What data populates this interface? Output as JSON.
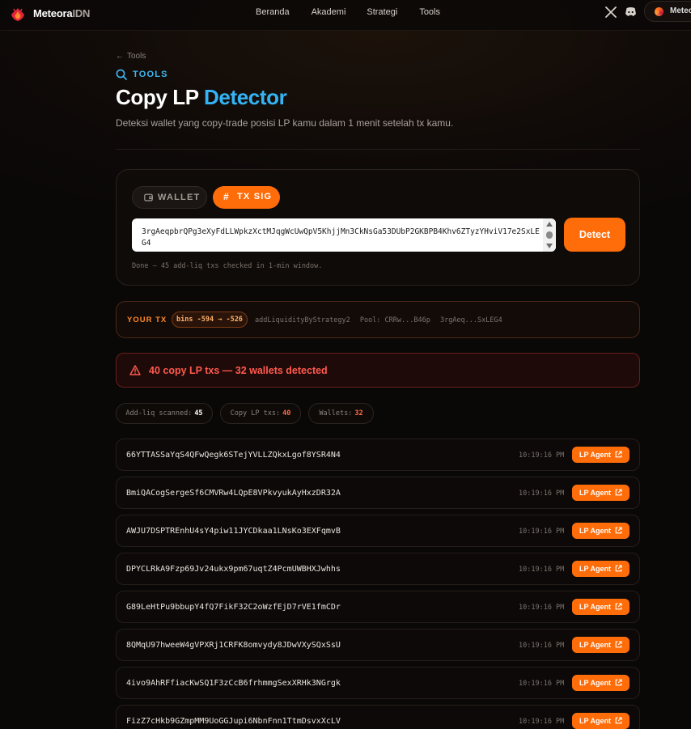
{
  "nav": {
    "brand_main": "Meteora",
    "brand_suffix": "IDN",
    "links": [
      "Beranda",
      "Akademi",
      "Strategi",
      "Tools"
    ],
    "app_label": "Meteo"
  },
  "header": {
    "back_label": "Tools",
    "section_label": "TOOLS",
    "title_white": "Copy LP",
    "title_accent": "Detector",
    "subtitle": "Deteksi wallet yang copy-trade posisi LP kamu dalam 1 menit setelah tx kamu."
  },
  "input_card": {
    "tabs": [
      {
        "label": "WALLET",
        "active": false
      },
      {
        "label": "TX SIG",
        "active": true
      }
    ],
    "signature_value": "3rgAeqpbrQPg3eXyFdLLWpkzXctMJqgWcUwQpV5KhjjMn3CkNsGa53DUbP2GKBPB4Khv6ZTyzYHviV17e2SxLEG4",
    "detect_label": "Detect",
    "status": "Done — 45 add-liq txs checked in 1-min window."
  },
  "your_tx": {
    "label": "YOUR TX",
    "bins": "bins -594 → -526",
    "method": "addLiquidityByStrategy2",
    "pool": "Pool: CRRw...B46p",
    "sig": "3rgAeq...SxLEG4"
  },
  "alert": {
    "text": "40 copy LP txs — 32 wallets detected"
  },
  "stats": {
    "scanned_label": "Add-liq scanned:",
    "scanned_value": "45",
    "copy_label": "Copy LP txs:",
    "copy_value": "40",
    "wallets_label": "Wallets:",
    "wallets_value": "32"
  },
  "results": [
    {
      "address": "66YTTASSaYqS4QFwQegk6STejYVLLZQkxLgof8YSR4N4",
      "time": "10:19:16 PM",
      "action": "LP Agent"
    },
    {
      "address": "BmiQACogSergeSf6CMVRw4LQpE8VPkvyukAyHxzDR32A",
      "time": "10:19:16 PM",
      "action": "LP Agent"
    },
    {
      "address": "AWJU7DSPTREnhU4sY4piw11JYCDkaa1LNsKo3EXFqmvB",
      "time": "10:19:16 PM",
      "action": "LP Agent"
    },
    {
      "address": "DPYCLRkA9Fzp69Jv24ukx9pm67uqtZ4PcmUWBHXJwhhs",
      "time": "10:19:16 PM",
      "action": "LP Agent"
    },
    {
      "address": "G89LeHtPu9bbupY4fQ7FikF32C2oWzfEjD7rVE1fmCDr",
      "time": "10:19:16 PM",
      "action": "LP Agent"
    },
    {
      "address": "8QMqU97hweeW4gVPXRj1CRFK8omvydy8JDwVXySQxSsU",
      "time": "10:19:16 PM",
      "action": "LP Agent"
    },
    {
      "address": "4ivo9AhRFfiacKwSQ1F3zCcB6frhmmgSexXRHk3NGrgk",
      "time": "10:19:16 PM",
      "action": "LP Agent"
    },
    {
      "address": "FizZ7cHkb9GZmpMM9UoGGJupi6NbnFnn1TtmDsvxXcLV",
      "time": "10:19:16 PM",
      "action": "LP Agent"
    }
  ],
  "colors": {
    "accent_orange": "#ff6d0a",
    "accent_blue": "#34b4f4",
    "alert_red": "#ff5a4e"
  }
}
